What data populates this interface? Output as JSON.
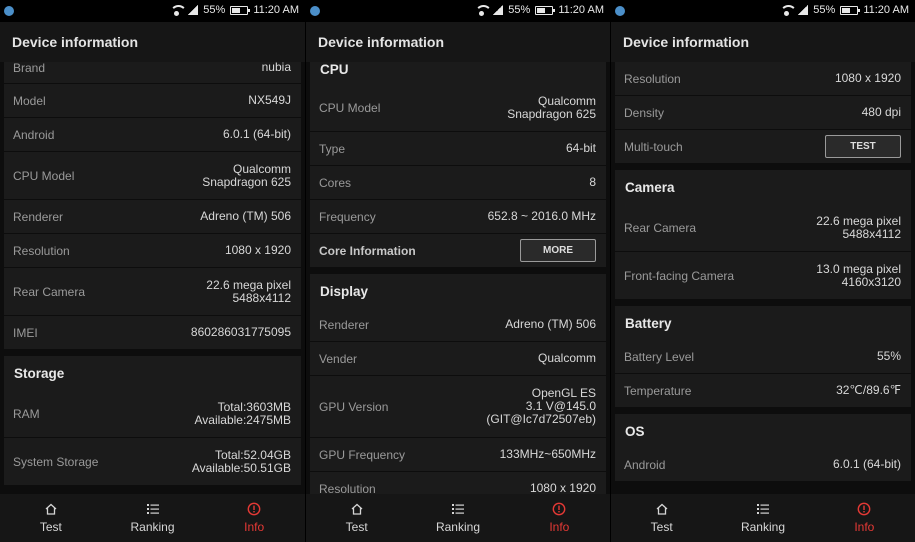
{
  "status": {
    "signal_strength": "55%",
    "time": "11:20 AM"
  },
  "app_title": "Device information",
  "nav": {
    "items": [
      {
        "label": "Test",
        "icon": "home-icon"
      },
      {
        "label": "Ranking",
        "icon": "list-icon"
      },
      {
        "label": "Info",
        "icon": "alert-icon",
        "active": true
      }
    ],
    "active_color": "#e53935"
  },
  "panel1": {
    "rows": [
      {
        "key": "Brand",
        "value": "nubia"
      },
      {
        "key": "Model",
        "value": "NX549J"
      },
      {
        "key": "Android",
        "value": "6.0.1 (64-bit)"
      },
      {
        "key": "CPU Model",
        "value_lines": [
          "Qualcomm",
          "Snapdragon 625"
        ]
      },
      {
        "key": "Renderer",
        "value": "Adreno (TM) 506"
      },
      {
        "key": "Resolution",
        "value": "1080 x 1920"
      },
      {
        "key": "Rear Camera",
        "value_lines": [
          "22.6 mega pixel",
          "5488x4112"
        ]
      },
      {
        "key": "IMEI",
        "value": "860286031775095"
      }
    ],
    "storage": {
      "title": "Storage",
      "rows": [
        {
          "key": "RAM",
          "value_lines": [
            "Total:3603MB",
            "Available:2475MB"
          ]
        },
        {
          "key": "System Storage",
          "value_lines": [
            "Total:52.04GB",
            "Available:50.51GB"
          ]
        }
      ]
    }
  },
  "panel2": {
    "cpu": {
      "title": "CPU",
      "rows": [
        {
          "key": "CPU Model",
          "value_lines": [
            "Qualcomm",
            "Snapdragon 625"
          ]
        },
        {
          "key": "Type",
          "value": "64-bit"
        },
        {
          "key": "Cores",
          "value": "8"
        },
        {
          "key": "Frequency",
          "value": "652.8 ~ 2016.0 MHz"
        }
      ],
      "core_info_label": "Core Information",
      "more_button": "MORE"
    },
    "display": {
      "title": "Display",
      "rows": [
        {
          "key": "Renderer",
          "value": "Adreno (TM) 506"
        },
        {
          "key": "Vender",
          "value": "Qualcomm"
        },
        {
          "key": "GPU Version",
          "value_lines": [
            "OpenGL ES",
            "3.1 V@145.0",
            "(GIT@Ic7d72507eb)"
          ]
        },
        {
          "key": "GPU Frequency",
          "value": "133MHz~650MHz"
        },
        {
          "key": "Resolution",
          "value": "1080 x 1920"
        }
      ]
    }
  },
  "panel3": {
    "display_rows": [
      {
        "key": "Resolution",
        "value": "1080 x 1920"
      },
      {
        "key": "Density",
        "value": "480 dpi"
      }
    ],
    "multitouch": {
      "key": "Multi-touch",
      "button": "TEST"
    },
    "camera": {
      "title": "Camera",
      "rows": [
        {
          "key": "Rear Camera",
          "value_lines": [
            "22.6 mega pixel",
            "5488x4112"
          ]
        },
        {
          "key": "Front-facing Camera",
          "value_lines": [
            "13.0 mega pixel",
            "4160x3120"
          ]
        }
      ]
    },
    "battery": {
      "title": "Battery",
      "rows": [
        {
          "key": "Battery Level",
          "value": "55%"
        },
        {
          "key": "Temperature",
          "value": "32℃/89.6℉"
        }
      ]
    },
    "os": {
      "title": "OS",
      "rows": [
        {
          "key": "Android",
          "value": "6.0.1 (64-bit)"
        }
      ]
    }
  }
}
